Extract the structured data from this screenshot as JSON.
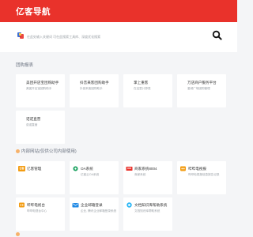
{
  "header": {
    "brand": "亿客导航"
  },
  "search": {
    "placeholder": "在此处输入关键词 可在此搜索工具库、深度优化搜索",
    "button_icon": "search-icon"
  },
  "sections": {
    "tools": {
      "title": "团购报表",
      "cards": [
        {
          "title": "美团开店宝团购助手",
          "desc": "美团开店宝团购助手"
        },
        {
          "title": "抖音来客团购助手",
          "desc": "抖音来客团购助手"
        },
        {
          "title": "掌上重客",
          "desc": "在这里计算表"
        },
        {
          "title": "万店商户服务平台",
          "desc": "爱城广场团购管理"
        },
        {
          "title": "诺诺直营",
          "desc": "诺诺直营"
        }
      ]
    },
    "intranet": {
      "title": "内部网站(仅供公司内部使用)",
      "cards": [
        {
          "title": "亿客管理",
          "desc": "",
          "icon": "yike-logo-icon",
          "icon_text": "亿客",
          "color": "#f39c12"
        },
        {
          "title": "OA系统",
          "desc": "亿客云OA系统",
          "icon": "oa-icon",
          "icon_text": "",
          "color": "#19a15f"
        },
        {
          "title": "商家系统8004",
          "desc": "商家系统",
          "icon": "merchant-icon",
          "icon_text": "",
          "color": "#e9322b"
        },
        {
          "title": "哔哔电视报",
          "desc": "哔哔电视报信息报告记录",
          "icon": "bibi-icon",
          "icon_text": "",
          "color": "#f39c12"
        },
        {
          "title": "哔哔电视台",
          "desc": "哔哔电视台中心",
          "icon": "bibi-tv-icon",
          "icon_text": "",
          "color": "#f39c12"
        },
        {
          "title": "企业邮箱登录",
          "desc": "企业, 腾讯企业邮箱登录系统",
          "icon": "mail-icon",
          "icon_text": "",
          "color": "#1e88e5"
        },
        {
          "title": "文档知识库帮助系统",
          "desc": "文档知识库帮助系统",
          "icon": "docs-icon",
          "icon_text": "",
          "color": "#29b6f6"
        }
      ]
    }
  }
}
